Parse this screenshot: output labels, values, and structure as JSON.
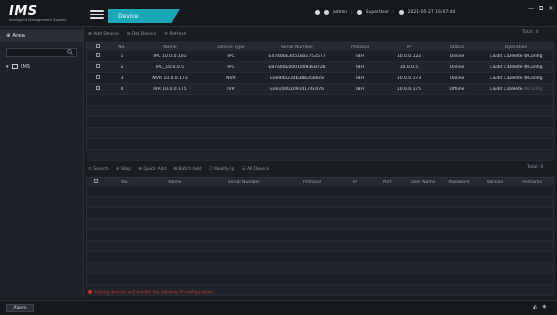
{
  "app": {
    "logo": "IMS",
    "subtitle": "Intelligent Management System",
    "tab": "Device"
  },
  "topbar": {
    "user": "admin",
    "role": "SuperUser",
    "datetime": "2021-05-27 16:07:44",
    "sep1": "|",
    "sep2": "|"
  },
  "window_controls": [
    "—",
    "⧉",
    "✕"
  ],
  "sidebar": {
    "title": "Area",
    "search_placeholder": "",
    "tree_root": "IMS"
  },
  "device_toolbar": {
    "add": "Add Device",
    "delete": "Del Device",
    "refresh": "Refresh",
    "total": "Total: 4"
  },
  "device_table": {
    "columns": [
      "",
      "No.",
      "Name",
      "Device Type",
      "Serial Number",
      "Protocol",
      "IP",
      "Status",
      "Operation"
    ],
    "rows": [
      {
        "no": "1",
        "name": "IPC 10.0.0.101",
        "type": "IPC",
        "serial": "E47400E30518a17535T7",
        "protocol": "IBH",
        "ip": "10.0.0.122",
        "status": "Online",
        "op_edit": "Edit",
        "op_delete": "Delete",
        "op_config": "Config"
      },
      {
        "no": "2",
        "name": "IPC_10.0.0.5",
        "type": "IPC",
        "serial": "E87a00E00010093E872b",
        "protocol": "IBH",
        "ip": "10.0.0.5",
        "status": "Online",
        "op_edit": "Edit",
        "op_delete": "Delete",
        "op_config": "Config"
      },
      {
        "no": "3",
        "name": "NVR 10.0.0.173",
        "type": "NVR",
        "serial": "E0e9d0234b38b35b6c8",
        "protocol": "IBH",
        "ip": "10.0.0.173",
        "status": "Online",
        "op_edit": "Edit",
        "op_delete": "Delete",
        "op_config": "Config"
      },
      {
        "no": "4",
        "name": "IVR 10.0.0.175",
        "type": "IVR",
        "serial": "E0e100020914174cd7b",
        "protocol": "IBH",
        "ip": "10.0.0.175",
        "status": "Offline",
        "op_edit": "Edit",
        "op_delete": "Delete",
        "op_config": "Config"
      }
    ]
  },
  "search_toolbar": {
    "search": "Search",
    "stop": "Stop",
    "quick_add": "Quick Add",
    "batch_add": "Batch Add",
    "modify_ip": "Modify Ip",
    "all_device": "All Device",
    "total": "Total: 0"
  },
  "search_table": {
    "columns": [
      "",
      "No.",
      "Name",
      "Serial Number",
      "Protocol",
      "IP",
      "Port",
      "User Name",
      "Password",
      "Version",
      "Remarks"
    ]
  },
  "warning": "Adding devices will modify the existing IP configuration.",
  "status_bar": {
    "alarm": "Alarm",
    "icons": [
      "bell-icon",
      "speaker-icon"
    ]
  },
  "colors": {
    "accent": "#1aa7b8",
    "background": "#1a1d22",
    "warning": "#c0392b"
  }
}
